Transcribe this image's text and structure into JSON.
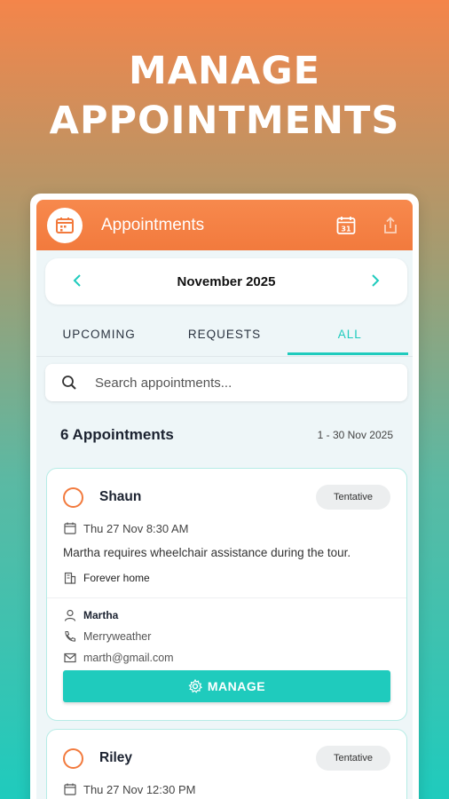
{
  "hero": {
    "line1": "MANAGE",
    "line2": "APPOINTMENTS"
  },
  "appbar": {
    "title": "Appointments",
    "calendar_icon_text": "31"
  },
  "month": {
    "label": "November 2025"
  },
  "tabs": [
    {
      "label": "UPCOMING"
    },
    {
      "label": "REQUESTS"
    },
    {
      "label": "ALL"
    }
  ],
  "search": {
    "placeholder": "Search appointments..."
  },
  "summary": {
    "count": "6 Appointments",
    "range": "1 - 30 Nov 2025"
  },
  "appointments": [
    {
      "name": "Shaun",
      "status": "Tentative",
      "datetime": "Thu 27 Nov 8:30 AM",
      "note": "Martha requires wheelchair assistance during the tour.",
      "location": "Forever home",
      "contact_name": "Martha",
      "contact_phone": "Merryweather",
      "contact_email": "marth@gmail.com",
      "action_label": "MANAGE"
    },
    {
      "name": "Riley",
      "status": "Tentative",
      "datetime": "Thu 27 Nov 12:30 PM"
    }
  ],
  "colors": {
    "accent_orange": "#f27a3d",
    "accent_teal": "#1fcbbd"
  }
}
